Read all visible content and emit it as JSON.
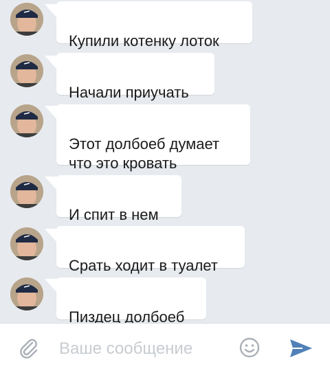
{
  "messages": [
    {
      "text": "Купили котенку лоток"
    },
    {
      "text": "Начали приучать"
    },
    {
      "text": "Этот долбоеб думает\nчто это кровать"
    },
    {
      "text": "И спит в нем"
    },
    {
      "text": "Срать ходит в туалет"
    },
    {
      "text": "Пиздец долбоеб"
    }
  ],
  "composer": {
    "placeholder": "Ваше сообщение",
    "attach_icon": "paperclip-icon",
    "emoji_icon": "smiley-icon",
    "send_icon": "send-arrow-icon"
  },
  "colors": {
    "background": "#e7ebef",
    "bubble": "#ffffff",
    "accent": "#5181b8"
  }
}
